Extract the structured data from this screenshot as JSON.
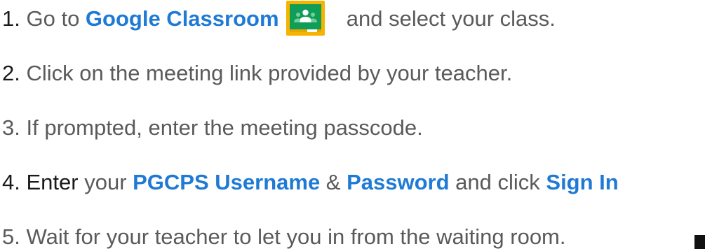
{
  "steps": [
    {
      "number": "1.",
      "before": "Go to ",
      "link": "Google Classroom",
      "after": "and select your class.",
      "icon": "google-classroom-icon"
    },
    {
      "number": "2.",
      "text": "Click on the meeting link provided by your teacher."
    },
    {
      "number": "3.",
      "text": "If prompted, enter the meeting passcode."
    },
    {
      "number": "4.",
      "enter": "Enter",
      "your": " your ",
      "username": "PGCPS Username",
      "amp": " & ",
      "password": "Password",
      "and_click": " and click ",
      "sign_in": "Sign In"
    },
    {
      "number": "5.",
      "text": "Wait for your teacher to let you in from the waiting room."
    }
  ],
  "colors": {
    "link_blue": "#1f7ad6",
    "text_gray": "#5a5a5a",
    "text_dark": "#1a1a1a",
    "classroom_yellow": "#f4b400",
    "classroom_green": "#0f9d58"
  }
}
